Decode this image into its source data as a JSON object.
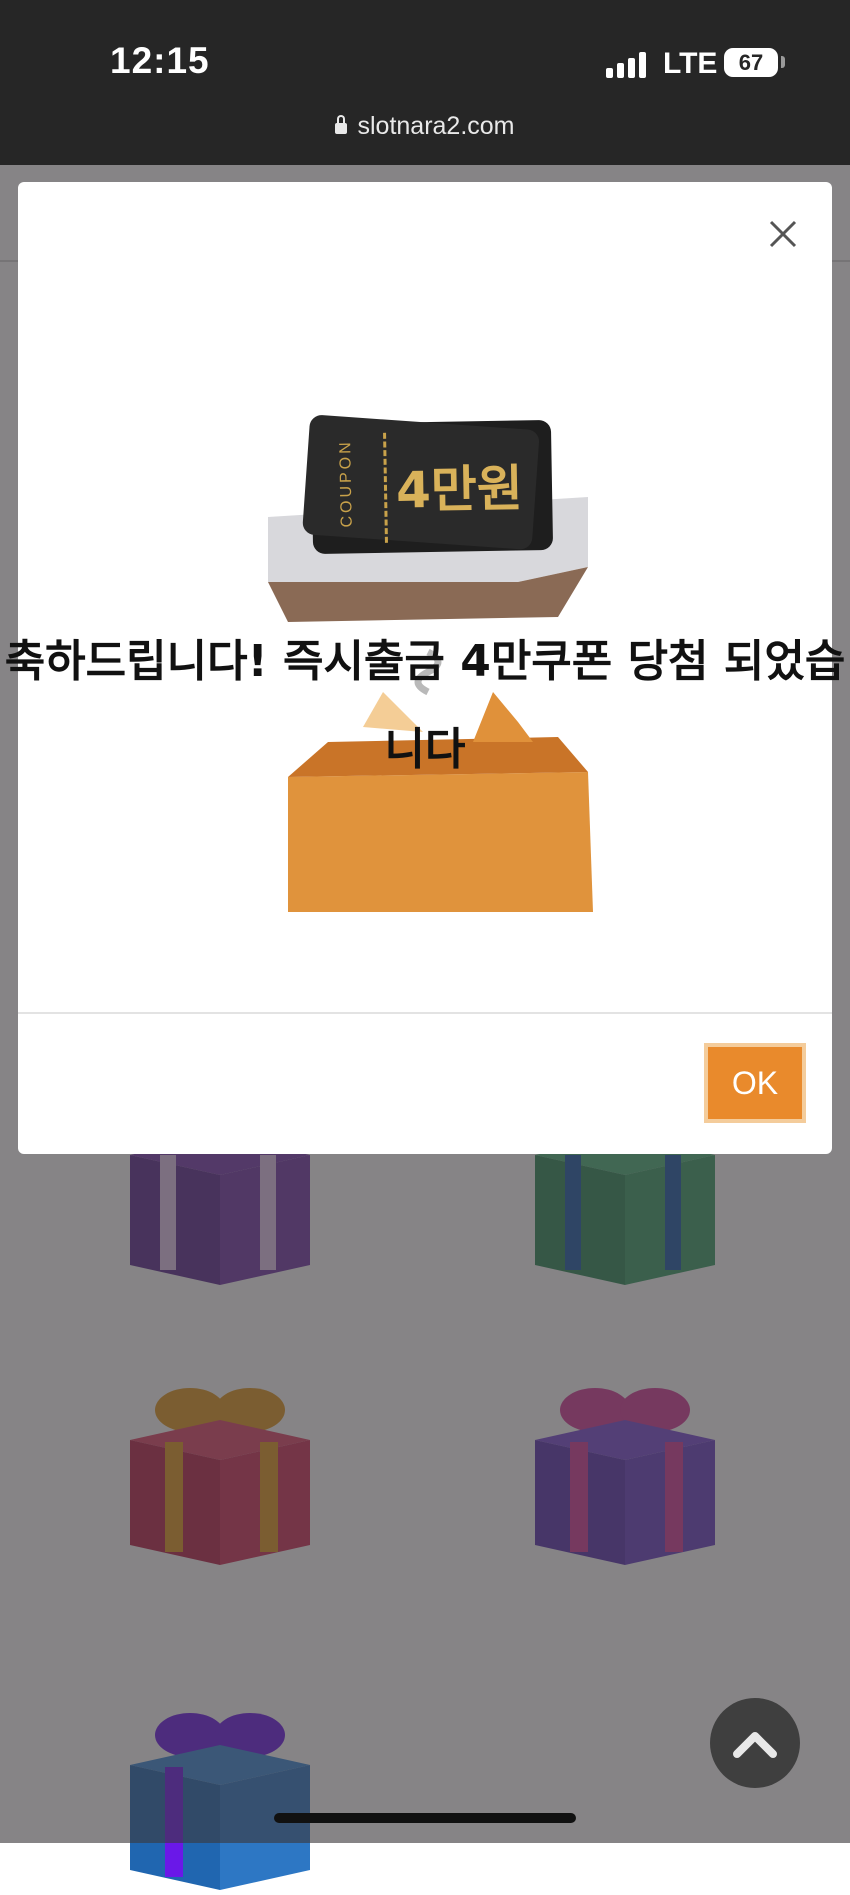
{
  "status_bar": {
    "time": "12:15",
    "network": "LTE",
    "battery": "67"
  },
  "browser": {
    "url": "slotnara2.com"
  },
  "modal": {
    "coupon_side_text": "COUPON",
    "coupon_amount": "4만원",
    "message": "축하드립니다! 즉시출금 4만쿠폰 당첨 되었습니다",
    "ok_label": "OK"
  },
  "icons": [
    "lock-icon",
    "close-icon",
    "chevron-up-icon",
    "signal-icon",
    "battery-icon"
  ],
  "colors": {
    "accent": "#e98a2c",
    "status_bar": "#262626",
    "overlay": "#555055"
  }
}
